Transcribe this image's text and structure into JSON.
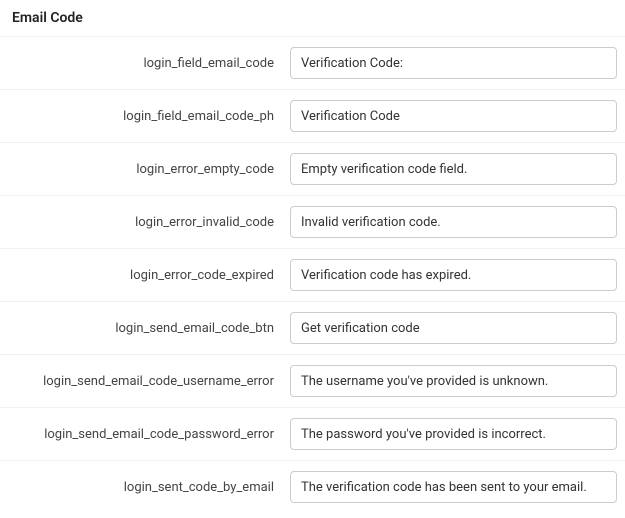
{
  "section": {
    "title": "Email Code"
  },
  "rows": [
    {
      "key": "login_field_email_code",
      "value": "Verification Code:"
    },
    {
      "key": "login_field_email_code_ph",
      "value": "Verification Code"
    },
    {
      "key": "login_error_empty_code",
      "value": "Empty verification code field."
    },
    {
      "key": "login_error_invalid_code",
      "value": "Invalid verification code."
    },
    {
      "key": "login_error_code_expired",
      "value": "Verification code has expired."
    },
    {
      "key": "login_send_email_code_btn",
      "value": "Get verification code"
    },
    {
      "key": "login_send_email_code_username_error",
      "value": "The username you've provided is unknown."
    },
    {
      "key": "login_send_email_code_password_error",
      "value": "The password you've provided is incorrect."
    },
    {
      "key": "login_sent_code_by_email",
      "value": "The verification code has been sent to your email."
    }
  ]
}
